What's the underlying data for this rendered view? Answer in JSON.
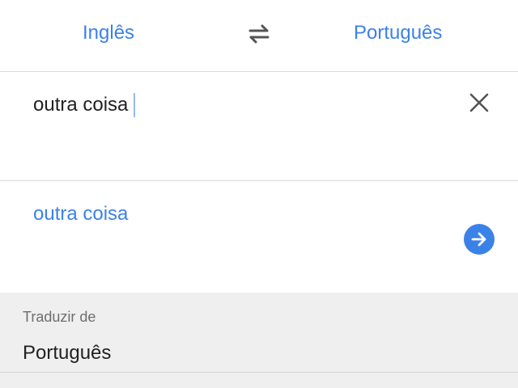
{
  "language_bar": {
    "source_language": "Inglês",
    "target_language": "Português",
    "swap_icon": "swap-arrows-icon"
  },
  "input": {
    "value": "outra coisa",
    "clear_icon": "close-icon"
  },
  "result": {
    "text": "outra coisa",
    "go_icon": "arrow-right-icon"
  },
  "translate_from": {
    "header": "Traduzir de",
    "options": [
      {
        "label": "Português"
      }
    ]
  },
  "colors": {
    "accent": "#3b82e8",
    "text": "#212121",
    "section_background": "#efefef"
  }
}
